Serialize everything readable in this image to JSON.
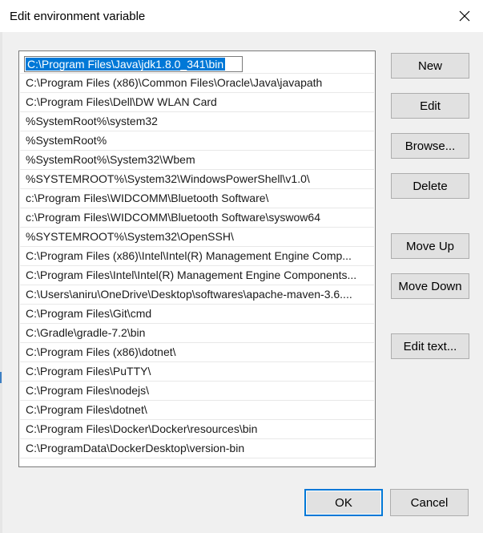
{
  "dialog": {
    "title": "Edit environment variable"
  },
  "list": {
    "selected_index": 0,
    "items": [
      "C:\\Program Files\\Java\\jdk1.8.0_341\\bin",
      "C:\\Program Files (x86)\\Common Files\\Oracle\\Java\\javapath",
      "C:\\Program Files\\Dell\\DW WLAN Card",
      "%SystemRoot%\\system32",
      "%SystemRoot%",
      "%SystemRoot%\\System32\\Wbem",
      "%SYSTEMROOT%\\System32\\WindowsPowerShell\\v1.0\\",
      "c:\\Program Files\\WIDCOMM\\Bluetooth Software\\",
      "c:\\Program Files\\WIDCOMM\\Bluetooth Software\\syswow64",
      "%SYSTEMROOT%\\System32\\OpenSSH\\",
      "C:\\Program Files (x86)\\Intel\\Intel(R) Management Engine Comp...",
      "C:\\Program Files\\Intel\\Intel(R) Management Engine Components...",
      "C:\\Users\\aniru\\OneDrive\\Desktop\\softwares\\apache-maven-3.6....",
      "C:\\Program Files\\Git\\cmd",
      "C:\\Gradle\\gradle-7.2\\bin",
      "C:\\Program Files (x86)\\dotnet\\",
      "C:\\Program Files\\PuTTY\\",
      "C:\\Program Files\\nodejs\\",
      "C:\\Program Files\\dotnet\\",
      "C:\\Program Files\\Docker\\Docker\\resources\\bin",
      "C:\\ProgramData\\DockerDesktop\\version-bin"
    ]
  },
  "buttons": {
    "new": "New",
    "edit": "Edit",
    "browse": "Browse...",
    "delete": "Delete",
    "move_up": "Move Up",
    "move_down": "Move Down",
    "edit_text": "Edit text...",
    "ok": "OK",
    "cancel": "Cancel"
  },
  "icons": {
    "close": "close-icon"
  },
  "colors": {
    "selection": "#0078d7",
    "default_button_border": "#0078d7"
  }
}
